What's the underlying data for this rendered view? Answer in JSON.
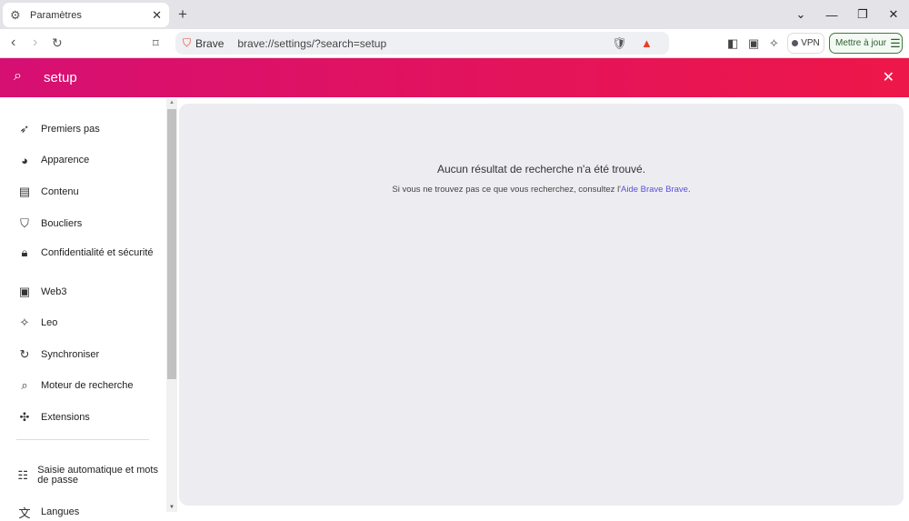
{
  "tab": {
    "title": "Paramètres"
  },
  "toolbar": {
    "site_label": "Brave",
    "url": "brave://settings/?search=setup",
    "vpn": "VPN",
    "update": "Mettre à jour"
  },
  "search": {
    "query": "setup"
  },
  "sidebar": {
    "items": [
      {
        "label": "Premiers pas",
        "icon": "rocket-icon"
      },
      {
        "label": "Apparence",
        "icon": "palette-icon"
      },
      {
        "label": "Contenu",
        "icon": "content-icon"
      },
      {
        "label": "Boucliers",
        "icon": "shield-icon"
      },
      {
        "label": "Confidentialité et sécurité",
        "icon": "lock-icon"
      },
      {
        "label": "Web3",
        "icon": "wallet-icon"
      },
      {
        "label": "Leo",
        "icon": "sparkle-icon"
      },
      {
        "label": "Synchroniser",
        "icon": "sync-icon"
      },
      {
        "label": "Moteur de recherche",
        "icon": "search-icon"
      },
      {
        "label": "Extensions",
        "icon": "puzzle-icon"
      },
      {
        "label": "Saisie automatique et mots de passe",
        "icon": "list-icon"
      },
      {
        "label": "Langues",
        "icon": "translate-icon"
      }
    ]
  },
  "main": {
    "heading": "Aucun résultat de recherche n'a été trouvé.",
    "sub_prefix": "Si vous ne trouvez pas ce que vous recherchez, consultez l'",
    "sub_link": "Aide Brave Brave",
    "sub_suffix": "."
  }
}
